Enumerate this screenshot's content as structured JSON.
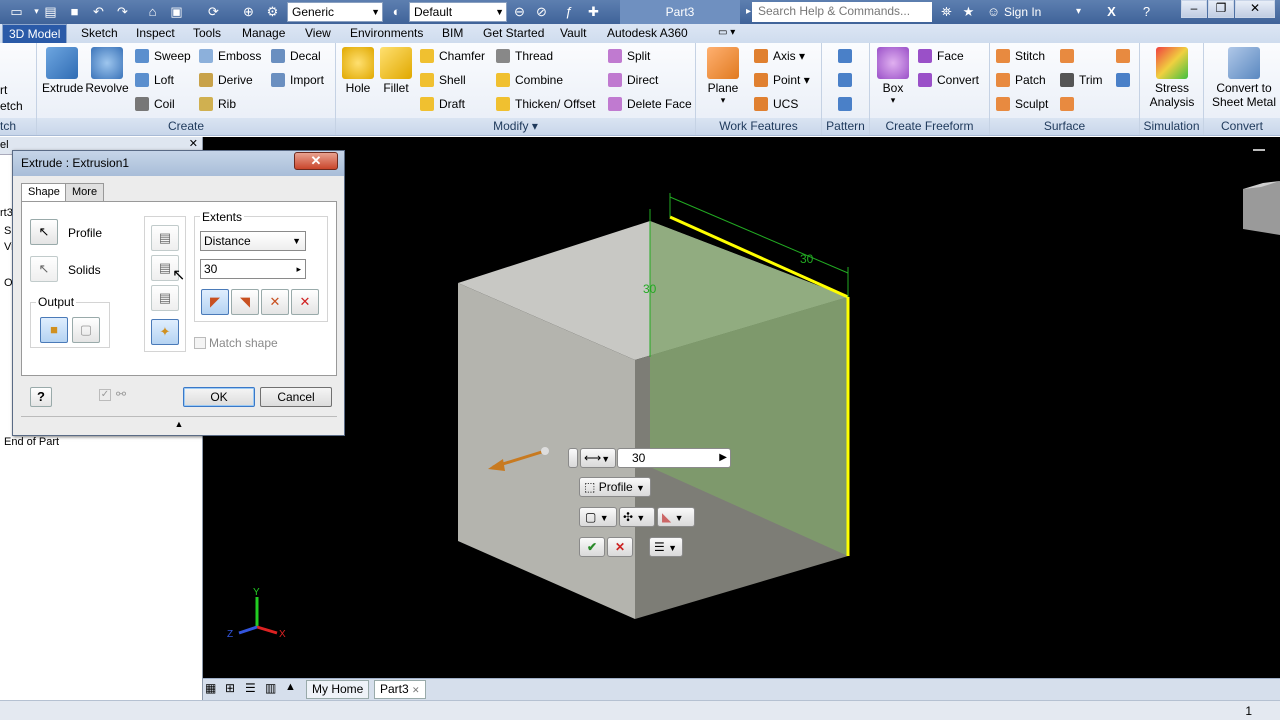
{
  "qat": {
    "material": "Generic",
    "appearance": "Default",
    "title": "Part3",
    "search_placeholder": "Search Help & Commands...",
    "signin": "Sign In"
  },
  "tabs": [
    "3D Model",
    "Sketch",
    "Inspect",
    "Tools",
    "Manage",
    "View",
    "Environments",
    "BIM",
    "Get Started",
    "Vault",
    "Autodesk A360"
  ],
  "ribbon": {
    "sketch": {
      "label1": "rt",
      "label2": "etch",
      "title": "tch"
    },
    "create": {
      "title": "Create",
      "extrude": "Extrude",
      "revolve": "Revolve",
      "sweep": "Sweep",
      "loft": "Loft",
      "coil": "Coil",
      "emboss": "Emboss",
      "derive": "Derive",
      "rib": "Rib",
      "decal": "Decal",
      "import": "Import"
    },
    "modify": {
      "title": "Modify",
      "hole": "Hole",
      "fillet": "Fillet",
      "chamfer": "Chamfer",
      "shell": "Shell",
      "draft": "Draft",
      "thread": "Thread",
      "combine": "Combine",
      "thicken": "Thicken/ Offset",
      "split": "Split",
      "direct": "Direct",
      "delete_face": "Delete Face"
    },
    "work": {
      "title": "Work Features",
      "plane": "Plane",
      "axis": "Axis",
      "point": "Point",
      "ucs": "UCS"
    },
    "pattern": {
      "title": "Pattern"
    },
    "freeform": {
      "title": "Create Freeform",
      "box": "Box",
      "face": "Face",
      "convert": "Convert"
    },
    "surface": {
      "title": "Surface",
      "stitch": "Stitch",
      "patch": "Patch",
      "sculpt": "Sculpt",
      "trim": "Trim"
    },
    "simulation": {
      "title": "Simulation",
      "stress": "Stress",
      "analysis": "Analysis"
    },
    "convert": {
      "title": "Convert",
      "line1": "Convert to",
      "line2": "Sheet Metal"
    }
  },
  "browser": {
    "end_of_part": "End of Part",
    "frag": [
      "el",
      "rt3",
      "S",
      "Vi",
      "O"
    ]
  },
  "dialog": {
    "title": "Extrude : Extrusion1",
    "tab_shape": "Shape",
    "tab_more": "More",
    "profile": "Profile",
    "solids": "Solids",
    "output": "Output",
    "extents": "Extents",
    "extent_type": "Distance",
    "distance": "30",
    "match_shape": "Match shape",
    "ok": "OK",
    "cancel": "Cancel"
  },
  "viewport": {
    "dim_height": "30",
    "dim_width": "30",
    "mini_value": "30",
    "mini_profile": "Profile"
  },
  "doctabs": {
    "home": "My Home",
    "part": "Part3"
  },
  "status": {
    "count": "1"
  },
  "colors": {
    "qat_bg": "#4a6fa5",
    "viewport_bg": "#000000",
    "edge_highlight": "#ffff00",
    "dimension": "#22aa22",
    "preview_face": "#7fa36a"
  }
}
